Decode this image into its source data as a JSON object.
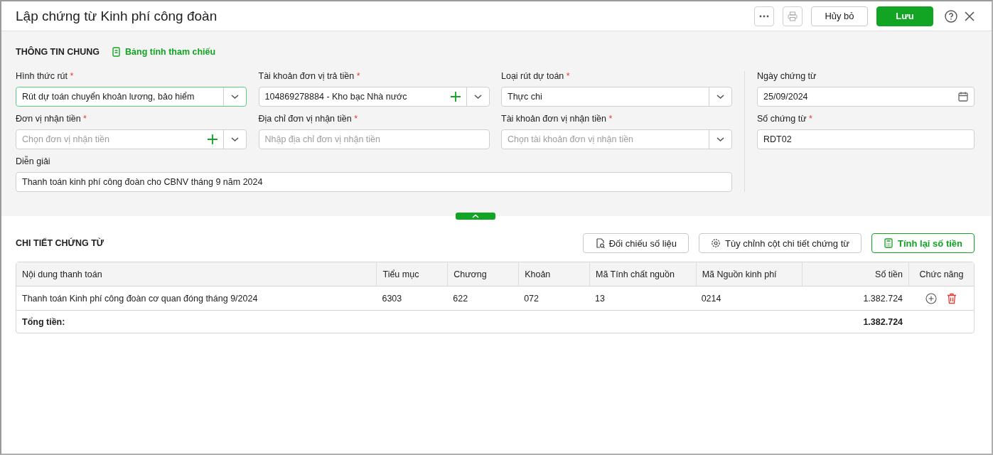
{
  "window": {
    "title": "Lập chứng từ Kinh phí công đoàn"
  },
  "toolbar": {
    "cancel": "Hủy bỏ",
    "save": "Lưu"
  },
  "general": {
    "heading": "THÔNG TIN CHUNG",
    "link": "Bảng tính tham chiếu",
    "fields": [
      {
        "kind": "select",
        "label": "Hình thức rút",
        "required_mark": "*",
        "value": "Rút dự toán chuyển khoản lương, bảo hiểm",
        "focused": true,
        "add": false
      },
      {
        "kind": "select",
        "label": "Tài khoản đơn vị trả tiền",
        "required_mark": "*",
        "value": "104869278884 - Kho bạc Nhà nước",
        "focused": false,
        "add": true
      },
      {
        "kind": "select",
        "label": "Loại rút dự toán",
        "required_mark": "*",
        "value": "Thực chi",
        "focused": false,
        "add": false
      },
      {
        "kind": "select",
        "label": "Đơn vị nhận tiền",
        "required_mark": "*",
        "placeholder": "Chọn đơn vị nhận tiền",
        "focused": false,
        "add": true
      },
      {
        "kind": "text",
        "label": "Địa chỉ đơn vị nhận tiền",
        "required_mark": "*",
        "placeholder": "Nhập địa chỉ đơn vị nhận tiền",
        "focused": false,
        "add": false
      },
      {
        "kind": "select",
        "label": "Tài khoản đơn vị nhận tiền",
        "required_mark": "*",
        "placeholder": "Chọn tài khoản đơn vị nhận tiền",
        "focused": false,
        "add": false
      },
      {
        "kind": "wide",
        "label": "Diễn giải",
        "value": "Thanh toán kinh phí công đoàn cho CBNV tháng 9 năm 2024",
        "focused": false,
        "add": false
      }
    ],
    "side_fields": [
      {
        "kind": "date",
        "label": "Ngày chứng từ",
        "value": "25/09/2024"
      },
      {
        "kind": "text",
        "label": "Số chứng từ",
        "required_mark": "*",
        "value": "RDT02"
      }
    ]
  },
  "detail": {
    "heading": "CHI TIẾT CHỨNG TỪ",
    "buttons": [
      {
        "kind": "compare",
        "label": "Đối chiếu số liệu"
      },
      {
        "kind": "settings",
        "label": "Tùy chỉnh cột chi tiết chứng từ"
      },
      {
        "kind": "recalc",
        "label": "Tính lại số tiền"
      }
    ],
    "table": {
      "columns": [
        "Nội dung thanh toán",
        "Tiểu mục",
        "Chương",
        "Khoản",
        "Mã Tính chất nguồn",
        "Mã Nguồn kinh phí",
        "Số tiền",
        "Chức năng"
      ],
      "rows": [
        [
          "Thanh toán Kinh phí công đoàn cơ quan đóng tháng 9/2024",
          "6303",
          "622",
          "072",
          "13",
          "0214",
          "1.382.724"
        ]
      ],
      "total_label": "Tổng tiền:",
      "total": "1.382.724"
    }
  }
}
